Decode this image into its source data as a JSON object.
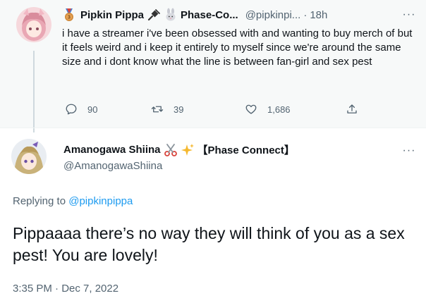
{
  "parent_tweet": {
    "display_name": "Pipkin Pippa",
    "affiliation": "Phase-Co...",
    "handle": "@pipkinpi...",
    "separator": "·",
    "time": "18h",
    "badge_icon": "bronze-medal-icon",
    "emojis": [
      "plug-icon",
      "rabbit-icon"
    ],
    "text": "i have a streamer i've been obsessed with and wanting to buy merch of but it feels weird and i keep it entirely to myself since we're around the same size and i dont know what the line is between fan-girl and sex pest",
    "more_label": "···",
    "stats": {
      "replies": "90",
      "retweets": "39",
      "likes": "1,686"
    }
  },
  "reply_tweet": {
    "display_name": "Amanogawa Shiina",
    "emojis": [
      "scissors-icon",
      "sparkles-icon"
    ],
    "affiliation": "【Phase Connect】",
    "handle": "@AmanogawaShiina",
    "more_label": "···",
    "replying_prefix": "Replying to",
    "replying_to": "@pipkinpippa",
    "text": "Pippaaaa there’s no way they will think of you as a sex pest! You are lovely!",
    "timestamp": "3:35 PM · Dec 7, 2022"
  },
  "colors": {
    "accent": "#1d9bf0",
    "secondary_text": "#536471",
    "parent_bg": "#f7f9f9"
  }
}
